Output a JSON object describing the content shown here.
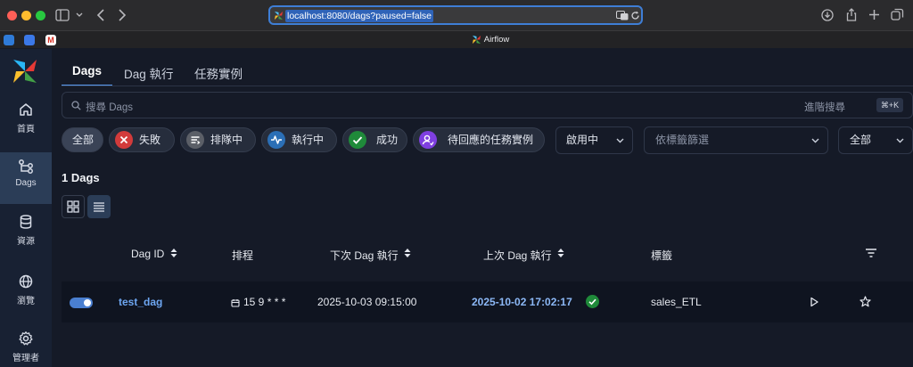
{
  "browser": {
    "url": "localhost:8080/dags?paused=false",
    "tab_title": "Airflow"
  },
  "sidebar": {
    "items": [
      {
        "label": "首頁",
        "icon": "home-icon",
        "active": false
      },
      {
        "label": "Dags",
        "icon": "dags-icon",
        "active": true
      },
      {
        "label": "資源",
        "icon": "database-icon",
        "active": false
      },
      {
        "label": "瀏覽",
        "icon": "globe-icon",
        "active": false
      },
      {
        "label": "管理者",
        "icon": "gear-icon",
        "active": false
      }
    ]
  },
  "tabs": [
    {
      "label": "Dags",
      "active": true
    },
    {
      "label": "Dag 執行",
      "active": false
    },
    {
      "label": "任務實例",
      "active": false
    }
  ],
  "search": {
    "placeholder": "搜尋 Dags",
    "advanced_label": "進階搜尋",
    "shortcut": "⌘+K"
  },
  "filters": {
    "all": "全部",
    "failed": "失敗",
    "queued": "排隊中",
    "running": "執行中",
    "success": "成功",
    "pending_review": "待回應的任務實例",
    "status_select": "啟用中",
    "tag_placeholder": "依標籤篩選",
    "scope_select": "全部"
  },
  "colors": {
    "failed": "#d23b3b",
    "queued": "#5b5f67",
    "running": "#2b6fb6",
    "success": "#1f8a3a",
    "pending": "#7f3fe0",
    "accent": "#5b9cf2"
  },
  "dag_count": "1 Dags",
  "table": {
    "headers": {
      "dag_id": "Dag ID",
      "schedule": "排程",
      "next_run": "下次 Dag 執行",
      "last_run": "上次 Dag 執行",
      "tags": "標籤"
    },
    "rows": [
      {
        "dag_id": "test_dag",
        "schedule": "15 9 * * *",
        "next_run": "2025-10-03 09:15:00",
        "last_run": "2025-10-02 17:02:17",
        "tag": "sales_ETL",
        "enabled": true
      }
    ]
  }
}
